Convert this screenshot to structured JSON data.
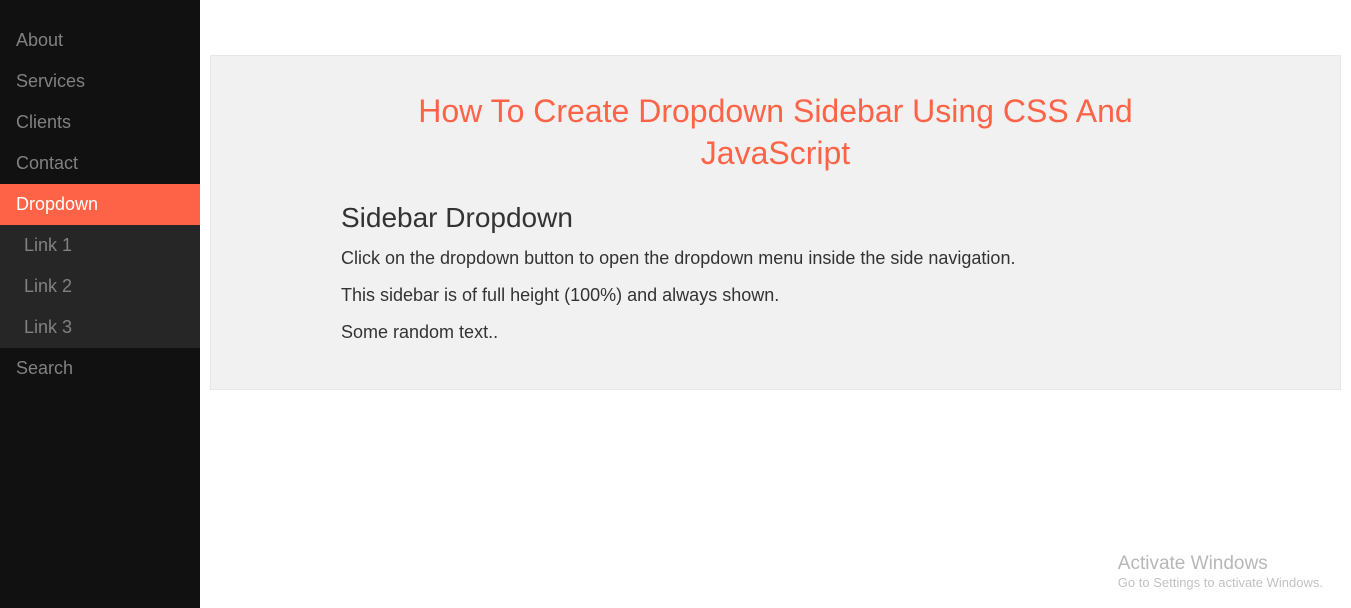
{
  "sidebar": {
    "items": [
      {
        "label": "About"
      },
      {
        "label": "Services"
      },
      {
        "label": "Clients"
      },
      {
        "label": "Contact"
      }
    ],
    "dropdown": {
      "label": "Dropdown",
      "links": [
        {
          "label": "Link 1"
        },
        {
          "label": "Link 2"
        },
        {
          "label": "Link 3"
        }
      ]
    },
    "search": {
      "label": "Search"
    }
  },
  "main": {
    "heading": "How To Create Dropdown Sidebar Using CSS And JavaScript",
    "subheading": "Sidebar Dropdown",
    "paragraphs": [
      "Click on the dropdown button to open the dropdown menu inside the side navigation.",
      "This sidebar is of full height (100%) and always shown.",
      "Some random text.."
    ]
  },
  "watermark": {
    "title": "Activate Windows",
    "subtitle": "Go to Settings to activate Windows."
  }
}
